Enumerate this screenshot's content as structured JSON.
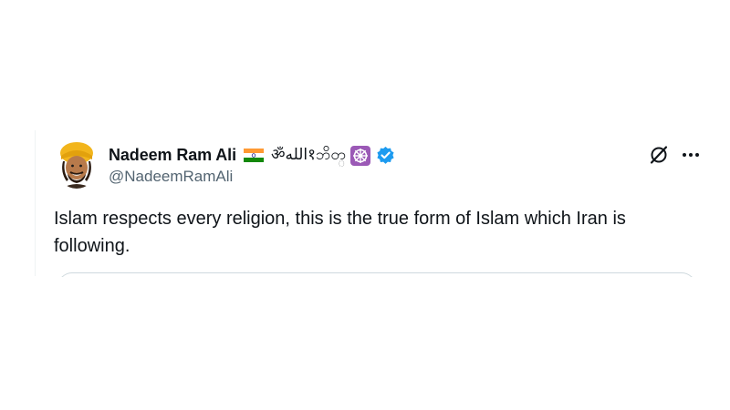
{
  "tweet": {
    "display_name": "Nadeem Ram Ali",
    "name_symbols": "ॐالله१ဘိတ္",
    "handle": "@NadeemRamAli",
    "text": "Islam respects every religion, this is the true form of Islam which Iran is following.",
    "icons": {
      "flag": "india-flag-icon",
      "dharma": "dharma-wheel-icon",
      "verified": "verified-badge-icon",
      "grok": "grok-icon",
      "more": "more-options-icon"
    }
  },
  "colors": {
    "text_primary": "#0f1419",
    "text_secondary": "#536471",
    "verified_blue": "#1d9bf0",
    "border": "#cfd9de",
    "dharma_bg": "#9b59b6"
  }
}
